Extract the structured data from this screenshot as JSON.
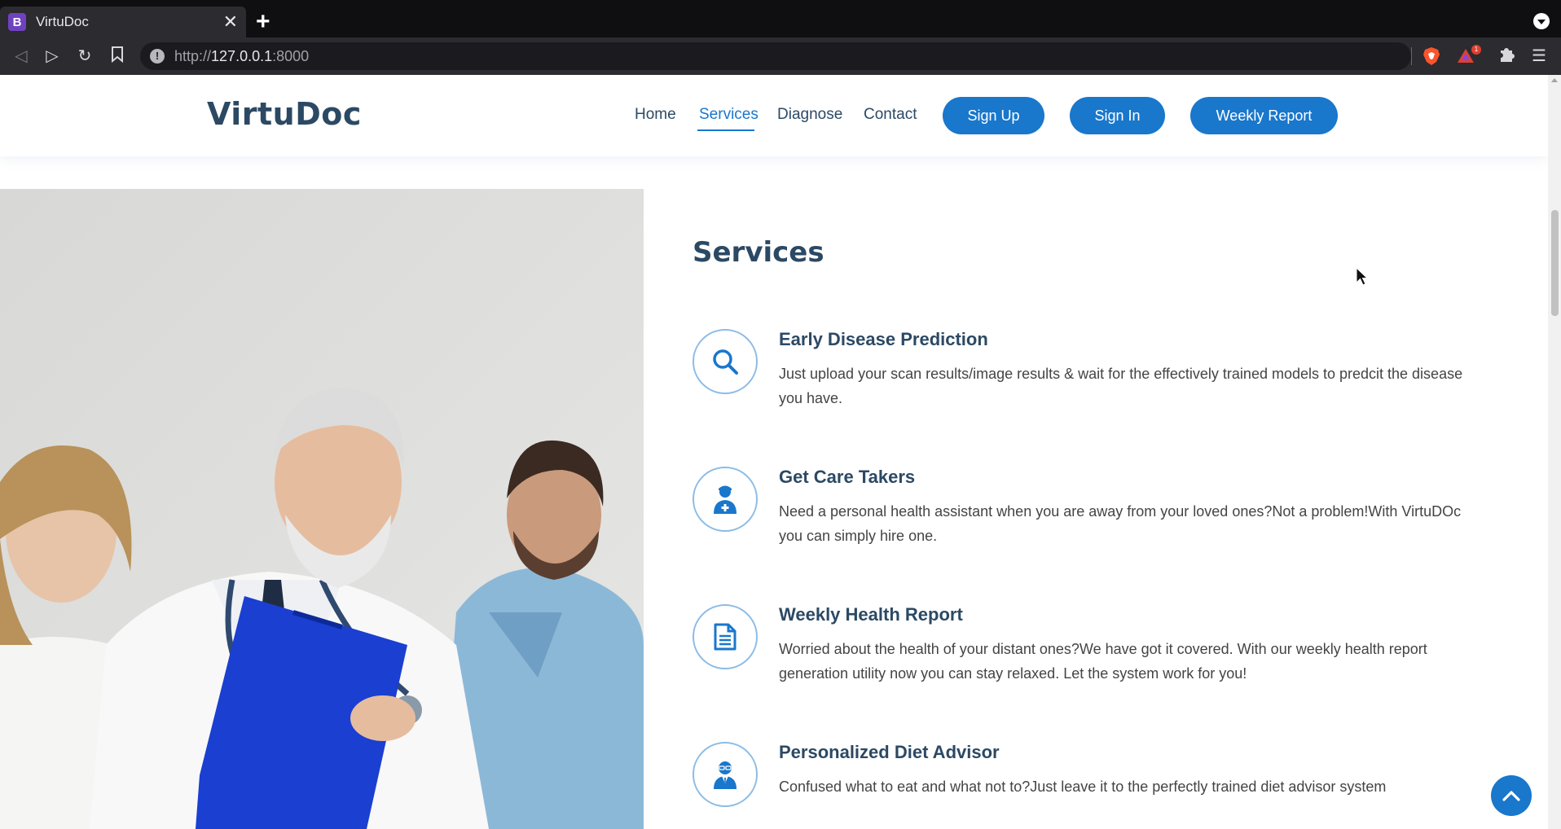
{
  "browser": {
    "tab_title": "VirtuDoc",
    "tab_favicon_letter": "B",
    "url_scheme": "http://",
    "url_host": "127.0.0.1",
    "url_port": ":8000",
    "rewards_badge": "1",
    "icons": [
      "back-icon",
      "forward-icon",
      "reload-icon",
      "bookmark-icon",
      "site-info-icon",
      "brave-shield-icon",
      "brave-rewards-icon",
      "extensions-icon",
      "menu-icon",
      "new-tab-icon",
      "close-icon"
    ]
  },
  "header": {
    "logo": "VirtuDoc",
    "nav": [
      {
        "label": "Home",
        "active": false
      },
      {
        "label": "Services",
        "active": true
      },
      {
        "label": "Diagnose",
        "active": false
      },
      {
        "label": "Contact",
        "active": false
      }
    ],
    "buttons": {
      "signup": "Sign Up",
      "signin": "Sign In",
      "weekly_report": "Weekly Report"
    }
  },
  "services": {
    "title": "Services",
    "items": [
      {
        "icon": "search-icon",
        "title": "Early Disease Prediction",
        "desc": "Just upload your scan results/image results & wait for the effectively trained models to predcit the disease you have."
      },
      {
        "icon": "nurse-icon",
        "title": "Get Care Takers",
        "desc": "Need a personal health assistant when you are away from your loved ones?Not a problem!With VirtuDOc you can simply hire one."
      },
      {
        "icon": "document-icon",
        "title": "Weekly Health Report",
        "desc": "Worried about the health of your distant ones?We have got it covered. With our weekly health report generation utility now you can stay relaxed. Let the system work for you!"
      },
      {
        "icon": "doctor-icon",
        "title": "Personalized Diet Advisor",
        "desc": "Confused what to eat and what not to?Just leave it to the perfectly trained diet advisor system"
      }
    ]
  },
  "colors": {
    "brand": "#1977cc",
    "heading": "#2c4964",
    "text": "#444444"
  }
}
